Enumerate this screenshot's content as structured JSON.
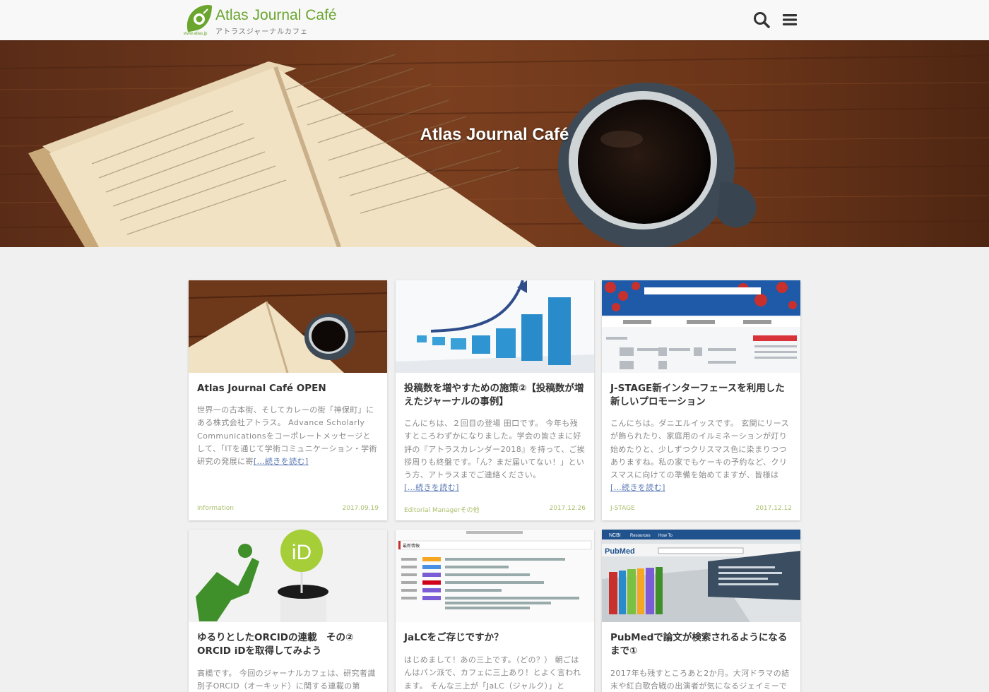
{
  "site": {
    "logo_title": "Atlas Journal Café",
    "logo_subtitle": "アトラスジャーナルカフェ",
    "logo_url_text": "www.atlas.jp",
    "hero_title": "Atlas Journal Café"
  },
  "colors": {
    "brand_green": "#6aa52e",
    "meta_green": "#a9bf6b",
    "link_blue": "#5b79b4",
    "background": "#f0f0f0"
  },
  "icons": {
    "search": "search-icon",
    "menu": "hamburger-menu-icon"
  },
  "posts": [
    {
      "title": "Atlas Journal Café OPEN",
      "excerpt": "世界一の古本街、そしてカレーの街「神保町」にある株式会社アトラス。 Advance Scholarly Communicationsをコーポレートメッセージとして、「ITを通じて学術コミュニケーション・学術研究の発展に寄",
      "read_more": "[…続きを読む]",
      "category": "information",
      "date": "2017.09.19"
    },
    {
      "title": "投稿数を増やすための施策②【投稿数が増えたジャーナルの事例】",
      "excerpt": "こんにちは、２回目の登場 田口です。 今年も残すところわずかになりました。学会の皆さまに好評の『アトラスカレンダー2018』を持って、ご挨拶周りも終盤です。「ん？まだ届いてない！」という方、アトラスまでご連絡ください。",
      "read_more": "[…続きを読む]",
      "category": "Editorial Managerその他",
      "date": "2017.12.26"
    },
    {
      "title": "J-STAGE新インターフェースを利用した新しいプロモーション",
      "excerpt": "こんにちは。ダニエルイッスです。 玄関にリースが飾られたり、家庭用のイルミネーションが灯り始めたりと、少しずつクリスマス色に染まりつつありますね。私の家でもケーキの予約など、クリスマスに向けての準備を始めてますが、皆様は",
      "read_more": "[…続きを読む]",
      "category": "J-STAGE",
      "date": "2017.12.12"
    },
    {
      "title": "ゆるりとしたORCIDの連載　その② ORCID iDを取得してみよう",
      "excerpt": "高橋です。 今回のジャーナルカフェは、研究者識別子ORCID（オーキッド）に関する連載の第",
      "thumb_text": "iD"
    },
    {
      "title": "JaLCをご存じですか？",
      "excerpt": "はじめまして！あの三上です。（どの？） 朝ごはんはパン派で、カフェに三上あり！とよく言われます。 そんな三上が「JaLC（ジャルク）」と",
      "thumb_header": "最新情報"
    },
    {
      "title": "PubMedで論文が検索されるようになるまで①",
      "excerpt": "2017年も残すところあと2か月。大河ドラマの結末や紅白歌合戦の出演者が気になるジェイミーで",
      "thumb_brand": "PubMed",
      "thumb_ncbi": "NCBI",
      "thumb_resources": "Resources",
      "thumb_howto": "How To"
    }
  ]
}
